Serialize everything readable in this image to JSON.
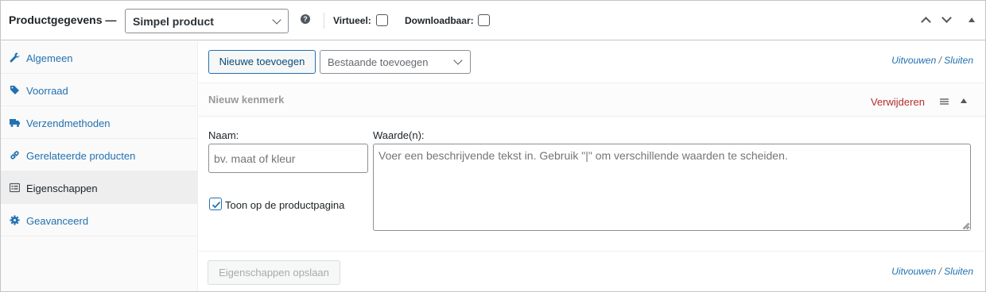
{
  "header": {
    "title": "Productgegevens —",
    "product_type": "Simpel product",
    "help_glyph": "?",
    "virtual_label": "Virtueel:",
    "downloadable_label": "Downloadbaar:"
  },
  "sidebar": {
    "items": [
      {
        "label": "Algemeen",
        "icon": "wrench-icon",
        "active": false
      },
      {
        "label": "Voorraad",
        "icon": "tag-icon",
        "active": false
      },
      {
        "label": "Verzendmethoden",
        "icon": "truck-icon",
        "active": false
      },
      {
        "label": "Gerelateerde producten",
        "icon": "link-icon",
        "active": false
      },
      {
        "label": "Eigenschappen",
        "icon": "list-view-icon",
        "active": true
      },
      {
        "label": "Geavanceerd",
        "icon": "gear-icon",
        "active": false
      }
    ]
  },
  "toolbar": {
    "add_new_label": "Nieuwe toevoegen",
    "add_existing_label": "Bestaande toevoegen",
    "expand_label": "Uitvouwen",
    "separator": "/",
    "close_label": "Sluiten"
  },
  "attribute": {
    "title": "Nieuw kenmerk",
    "remove_label": "Verwijderen",
    "name_label": "Naam:",
    "name_placeholder": "bv. maat of kleur",
    "values_label": "Waarde(n):",
    "values_placeholder": "Voer een beschrijvende tekst in. Gebruik \"|\" om verschillende waarden te scheiden.",
    "visible_label": "Toon op de productpagina",
    "visible_checked": true
  },
  "footer": {
    "save_label": "Eigenschappen opslaan",
    "expand_label": "Uitvouwen",
    "separator": "/",
    "close_label": "Sluiten"
  },
  "colors": {
    "link": "#2271b1",
    "danger": "#b32d2e",
    "border": "#c3c4c7"
  }
}
